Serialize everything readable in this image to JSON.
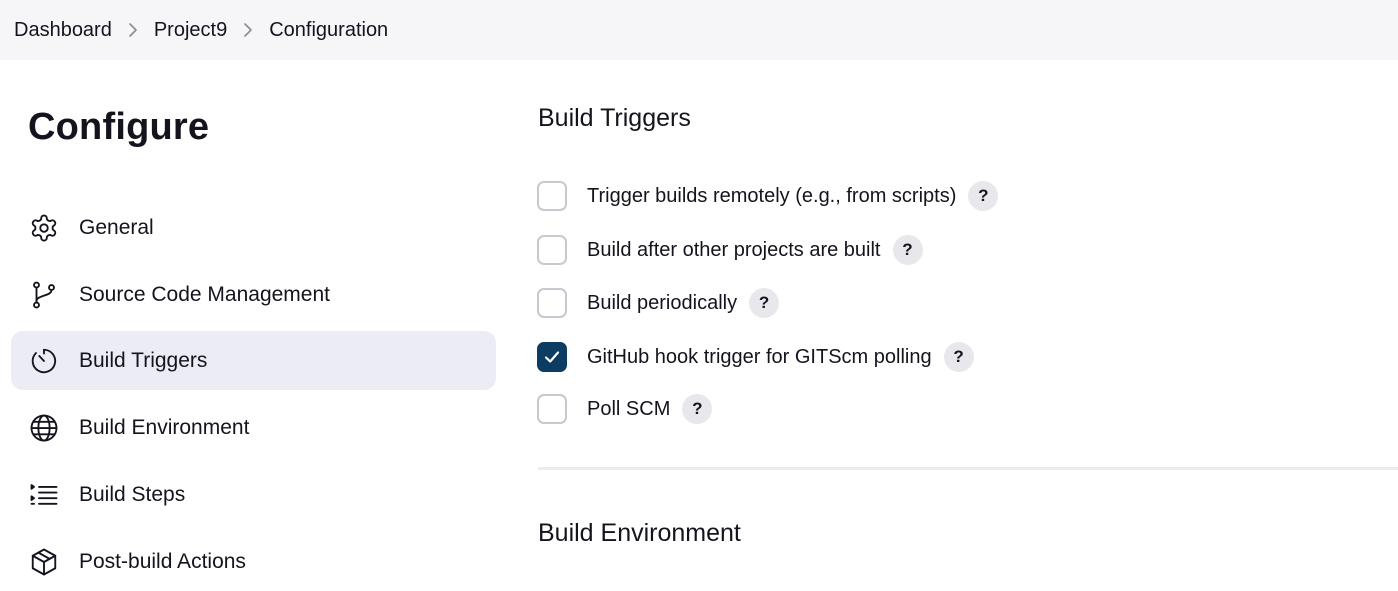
{
  "breadcrumb": {
    "items": [
      "Dashboard",
      "Project9",
      "Configuration"
    ],
    "separator_icon": "chevron-right-icon"
  },
  "sidebar": {
    "title": "Configure",
    "items": [
      {
        "label": "General",
        "icon": "gear-icon",
        "active": false
      },
      {
        "label": "Source Code Management",
        "icon": "git-branch-icon",
        "active": false
      },
      {
        "label": "Build Triggers",
        "icon": "timer-icon",
        "active": true
      },
      {
        "label": "Build Environment",
        "icon": "globe-icon",
        "active": false
      },
      {
        "label": "Build Steps",
        "icon": "list-steps-icon",
        "active": false
      },
      {
        "label": "Post-build Actions",
        "icon": "package-icon",
        "active": false
      }
    ]
  },
  "main": {
    "build_triggers": {
      "title": "Build Triggers",
      "options": [
        {
          "label": "Trigger builds remotely (e.g., from scripts)",
          "checked": false,
          "help": "?"
        },
        {
          "label": "Build after other projects are built",
          "checked": false,
          "help": "?"
        },
        {
          "label": "Build periodically",
          "checked": false,
          "help": "?"
        },
        {
          "label": "GitHub hook trigger for GITScm polling",
          "checked": true,
          "help": "?"
        },
        {
          "label": "Poll SCM",
          "checked": false,
          "help": "?"
        }
      ]
    },
    "build_environment": {
      "title": "Build Environment"
    }
  },
  "colors": {
    "breadcrumb_bg": "#f6f6f9",
    "active_nav_bg": "#ececf5",
    "checkbox_checked": "#0c3c61",
    "help_bg": "#e8e8ec",
    "text": "#14141f"
  }
}
